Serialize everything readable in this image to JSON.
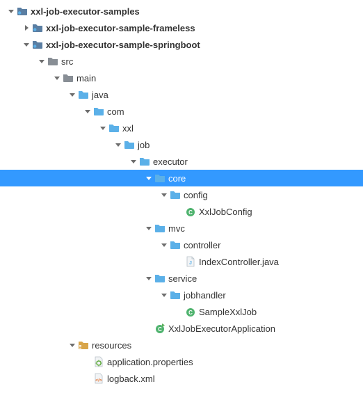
{
  "colors": {
    "selection_bg": "#3399ff",
    "arrow": "#6e6e6e",
    "arrow_selected": "#ffffff",
    "folder_module": "#5a7ea2",
    "folder_plain": "#888e95",
    "folder_package": "#5bb0e8",
    "folder_source": "#5bb0e8",
    "folder_resources": "#d8a54a",
    "class_circle": "#4fb36e",
    "java_file": "#5bb0e8",
    "properties_file": "#6ab04a",
    "xml_file": "#e57330"
  },
  "tree": [
    {
      "depth": 0,
      "expand": "down",
      "icon": "module-folder",
      "label": "xxl-job-executor-samples",
      "bold": true,
      "interactable": true
    },
    {
      "depth": 1,
      "expand": "right",
      "icon": "module-folder",
      "label": "xxl-job-executor-sample-frameless",
      "bold": true,
      "interactable": true
    },
    {
      "depth": 1,
      "expand": "down",
      "icon": "module-folder",
      "label": "xxl-job-executor-sample-springboot",
      "bold": true,
      "interactable": true
    },
    {
      "depth": 2,
      "expand": "down",
      "icon": "plain-folder",
      "label": "src",
      "interactable": true
    },
    {
      "depth": 3,
      "expand": "down",
      "icon": "plain-folder",
      "label": "main",
      "interactable": true
    },
    {
      "depth": 4,
      "expand": "down",
      "icon": "source-folder",
      "label": "java",
      "interactable": true
    },
    {
      "depth": 5,
      "expand": "down",
      "icon": "package-folder",
      "label": "com",
      "interactable": true
    },
    {
      "depth": 6,
      "expand": "down",
      "icon": "package-folder",
      "label": "xxl",
      "interactable": true
    },
    {
      "depth": 7,
      "expand": "down",
      "icon": "package-folder",
      "label": "job",
      "interactable": true
    },
    {
      "depth": 8,
      "expand": "down",
      "icon": "package-folder",
      "label": "executor",
      "interactable": true
    },
    {
      "depth": 9,
      "expand": "down",
      "icon": "package-folder",
      "label": "core",
      "selected": true,
      "interactable": true
    },
    {
      "depth": 10,
      "expand": "down",
      "icon": "package-folder",
      "label": "config",
      "interactable": true
    },
    {
      "depth": 11,
      "expand": "none",
      "icon": "class",
      "label": "XxlJobConfig",
      "interactable": true
    },
    {
      "depth": 9,
      "expand": "down",
      "icon": "package-folder",
      "label": "mvc",
      "interactable": true
    },
    {
      "depth": 10,
      "expand": "down",
      "icon": "package-folder",
      "label": "controller",
      "interactable": true
    },
    {
      "depth": 11,
      "expand": "none",
      "icon": "java-file",
      "label": "IndexController.java",
      "interactable": true
    },
    {
      "depth": 9,
      "expand": "down",
      "icon": "package-folder",
      "label": "service",
      "interactable": true
    },
    {
      "depth": 10,
      "expand": "down",
      "icon": "package-folder",
      "label": "jobhandler",
      "interactable": true
    },
    {
      "depth": 11,
      "expand": "none",
      "icon": "class",
      "label": "SampleXxlJob",
      "interactable": true
    },
    {
      "depth": 9,
      "expand": "none",
      "icon": "class-run",
      "label": "XxlJobExecutorApplication",
      "interactable": true
    },
    {
      "depth": 4,
      "expand": "down",
      "icon": "resources-folder",
      "label": "resources",
      "interactable": true
    },
    {
      "depth": 5,
      "expand": "none",
      "icon": "properties-file",
      "label": "application.properties",
      "interactable": true
    },
    {
      "depth": 5,
      "expand": "none",
      "icon": "xml-file",
      "label": "logback.xml",
      "interactable": true
    }
  ]
}
